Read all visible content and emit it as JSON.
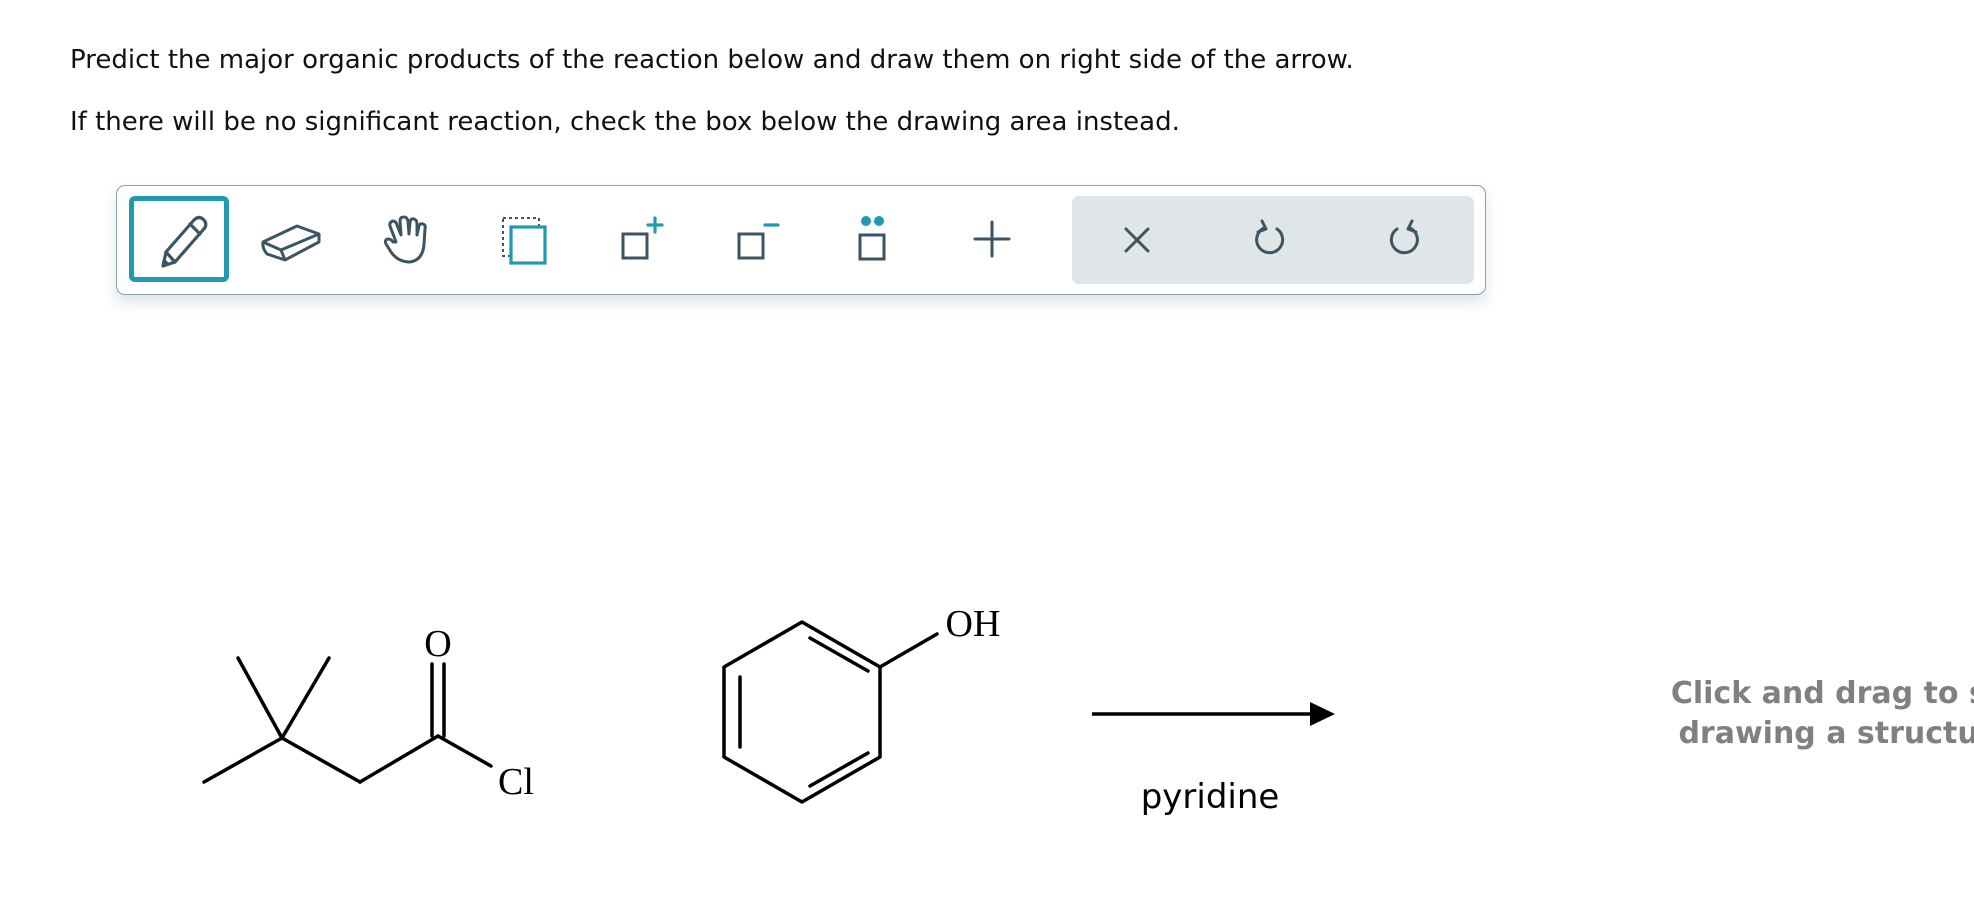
{
  "instructions": {
    "line1": "Predict the major organic products of the reaction below and draw them on right side of the arrow.",
    "line2": "If there will be no significant reaction, check the box below the drawing area instead."
  },
  "toolbar": {
    "tools": [
      {
        "name": "pencil-icon",
        "active": true
      },
      {
        "name": "eraser-icon",
        "active": false
      },
      {
        "name": "hand-icon",
        "active": false
      },
      {
        "name": "select-icon",
        "active": false
      },
      {
        "name": "increase-charge-icon",
        "active": false
      },
      {
        "name": "decrease-charge-icon",
        "active": false
      },
      {
        "name": "lone-pair-icon",
        "active": false
      },
      {
        "name": "plus-icon",
        "active": false
      }
    ],
    "actions": [
      "clear-icon",
      "undo-icon",
      "redo-icon"
    ],
    "accent_color": "#1f9ab0",
    "icon_color": "#3d5563"
  },
  "reaction": {
    "reactant1": {
      "oxygen_label": "O",
      "chlorine_label": "Cl"
    },
    "reactant2": {
      "hydroxyl_label": "OH"
    },
    "reagent": "pyridine"
  },
  "drawing_area": {
    "placeholder_line1": "Click and drag to st",
    "placeholder_line2": "drawing a structur"
  }
}
